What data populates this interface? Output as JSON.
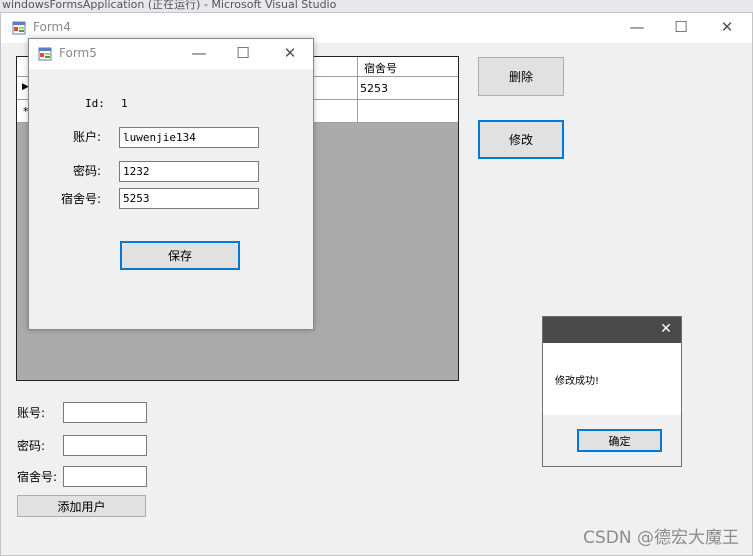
{
  "vs_title_strip": "windowsFormsApplication (正在运行) - Microsoft Visual Studio",
  "form4": {
    "title": "Form4",
    "controls": {
      "minimize": "—",
      "maximize": "☐",
      "close": "✕"
    },
    "grid": {
      "header_visible_col": "宿舍号",
      "rows": [
        {
          "marker": "▶",
          "dorm": "5253"
        },
        {
          "marker": "*",
          "dorm": ""
        }
      ]
    },
    "delete_button": "删除",
    "edit_button": "修改",
    "account_label": "账号:",
    "password_label": "密码:",
    "dorm_label": "宿舍号:",
    "account_value": "",
    "password_value": "",
    "dorm_value": "",
    "add_user_button": "添加用户"
  },
  "form5": {
    "title": "Form5",
    "controls": {
      "minimize": "—",
      "maximize": "☐",
      "close": "✕"
    },
    "id_label": "Id:",
    "id_value": "1",
    "account_label": "账户:",
    "account_value": "luwenjie134",
    "password_label": "密码:",
    "password_value": "1232",
    "dorm_label": "宿舍号:",
    "dorm_value": "5253",
    "save_button": "保存"
  },
  "message_box": {
    "close": "✕",
    "message": "修改成功!",
    "ok_button": "确定"
  },
  "watermark": "CSDN @德宏大魔王",
  "colors": {
    "focus_border": "#0078d7",
    "grid_bg": "#ababab",
    "msgbox_title": "#4a4a4a"
  }
}
